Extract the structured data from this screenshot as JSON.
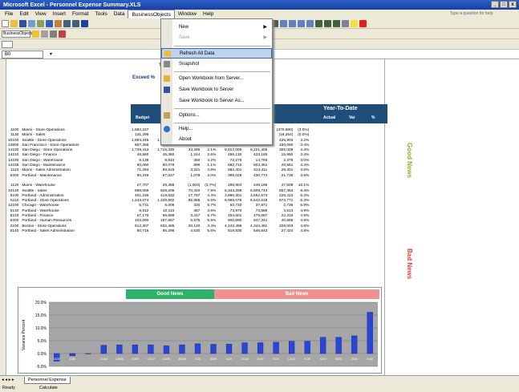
{
  "window": {
    "title": "Microsoft Excel - Personnel Expense Summary.XLS",
    "controls": [
      "_",
      "□",
      "x"
    ]
  },
  "menu": {
    "items": [
      "File",
      "Edit",
      "View",
      "Insert",
      "Format",
      "Tools",
      "Data",
      "BusinessObjects",
      "Window",
      "Help"
    ],
    "help_placeholder": "Type a question for help"
  },
  "formula": {
    "namebox": "B0"
  },
  "toolbar2": {
    "label": "BusinessObjects"
  },
  "dropdown": {
    "items": [
      {
        "label": "New",
        "arrow": "▶",
        "disabled": false
      },
      {
        "label": "Save",
        "arrow": "▶",
        "disabled": true
      },
      {
        "label": "Refresh All Data",
        "highlight": true
      },
      {
        "label": "Snapshot"
      },
      {
        "label": "Open Workbook from Server..."
      },
      {
        "label": "Save Workbook to Server"
      },
      {
        "label": "Save Workbook to Server As..."
      },
      {
        "label": "Options..."
      },
      {
        "label": "Help..."
      },
      {
        "label": "About"
      }
    ]
  },
  "report": {
    "title": "Te",
    "subtitle": "Exceed %",
    "ytd_title": "Year-To-Date",
    "col_budget": "Budget",
    "col_actual": "Actual",
    "col_var": "Var",
    "col_pct": "%",
    "side_good": "Good News",
    "side_bad": "Bad News"
  },
  "rows_good": [
    {
      "code": "1100",
      "name": "Miami - Store Operations",
      "b": "1,882,227",
      "a": "",
      "v": "",
      "p": "",
      "ytdb": "12,087,284",
      "ytda": "12,457,724",
      "ytdv": "(370,980)",
      "ytdp": "(3.0%)"
    },
    {
      "code": "1130",
      "name": "Miami - Sales",
      "b": "131,299",
      "a": "",
      "v": "",
      "p": "",
      "ytdb": "854,290",
      "ytda": "868,618",
      "ytdv": "(16,264)",
      "ytdp": "(0.0%)"
    },
    {
      "code": "10100",
      "name": "Seattle - Store Operations",
      "b": "1,894,345",
      "a": "1,780,290",
      "v": "88,810",
      "p": "5.0%",
      "ytdb": "12,894,300",
      "ytda": "12,418,471",
      "ytdv": "425,903",
      "ytdp": "3.2%"
    },
    {
      "code": "13500",
      "name": "San Francisco - Store Operations",
      "b": "657,265",
      "a": "630,000",
      "v": "22,247",
      "p": "3.7%",
      "ytdb": "4,248,844",
      "ytda": "4,088,634",
      "ytdv": "160,080",
      "ytdp": "3.4%"
    },
    {
      "code": "14100",
      "name": "San Diego - Store Operations",
      "b": "1,749,413",
      "a": "1,715,330",
      "v": "33,280",
      "p": "2.1%",
      "ytdb": "9,917,000",
      "ytda": "9,221,405",
      "ytdv": "305,009",
      "ytdp": "3.4%"
    },
    {
      "code": "14210",
      "name": "San Diego - Finance",
      "b": "46,560",
      "a": "45,360",
      "v": "1,244",
      "p": "2.6%",
      "ytdb": "456,130",
      "ytda": "433,165",
      "ytdv": "15,950",
      "ytdp": "3.4%"
    },
    {
      "code": "14230",
      "name": "San Diego - Warehouse",
      "b": "9,139",
      "a": "8,810",
      "v": "350",
      "p": "4.2%",
      "ytdb": "72,275",
      "ytda": "14,793",
      "ytdv": "2,375",
      "ytdp": "3.0%"
    },
    {
      "code": "14235",
      "name": "San Diego - Maintenance",
      "b": "80,060",
      "a": "80,079",
      "v": "896",
      "p": "1.1%",
      "ytdb": "592,710",
      "ytda": "603,361",
      "ytdv": "20,551",
      "ytdp": "3.4%"
    },
    {
      "code": "1110",
      "name": "Miami - Sales Administration",
      "b": "71,294",
      "a": "89,815",
      "v": "3,321",
      "p": "4.8%",
      "ytdb": "582,401",
      "ytda": "613,411",
      "ytdv": "29,301",
      "ytdp": "3.8%"
    },
    {
      "code": "5200",
      "name": "Portland - Maintenance",
      "b": "60,249",
      "a": "67,027",
      "v": "1,078",
      "p": "2.0%",
      "ytdb": "399,028",
      "ytda": "430,774",
      "ytdv": "21,736",
      "ytdp": "3.6%"
    }
  ],
  "rows_bad": [
    {
      "code": "1120",
      "name": "Miami - Warehouse",
      "b": "27,707",
      "a": "28,358",
      "v": "(1,003)",
      "p": "(3.7%)",
      "ytdb": "288,804",
      "ytda": "246,186",
      "ytdv": "47,608",
      "ytdp": "16.1%"
    },
    {
      "code": "10120",
      "name": "Seattle - Sales",
      "b": "899,059",
      "a": "829,206",
      "v": "70,320",
      "p": "7.8%",
      "ytdb": "6,343,298",
      "ytda": "5,809,743",
      "ytdv": "557,364",
      "ytdp": "8.4%"
    },
    {
      "code": "5100",
      "name": "Portland - Administration",
      "b": "401,236",
      "a": "419,832",
      "v": "17,797",
      "p": "4.4%",
      "ytdb": "3,890,301",
      "ytda": "3,652,673",
      "ytdv": "228,222",
      "ytdp": "6.3%"
    },
    {
      "code": "5110",
      "name": "Portland - Store Operations",
      "b": "1,243,074",
      "a": "1,328,902",
      "v": "85,865",
      "p": "6.5%",
      "ytdb": "8,969,076",
      "ytda": "8,542,618",
      "ytdv": "573,771",
      "ytdp": "6.3%"
    },
    {
      "code": "12100",
      "name": "Chicago - Warehouse",
      "b": "5,731",
      "a": "6,009",
      "v": "320",
      "p": "5.7%",
      "ytdb": "83,733",
      "ytda": "37,871",
      "ytdv": "2,736",
      "ytdp": "6.9%"
    },
    {
      "code": "5130",
      "name": "Portland - Warehouse",
      "b": "9,612",
      "a": "10,110",
      "v": "367",
      "p": "3.6%",
      "ytdb": "73,970",
      "ytda": "73,886",
      "ytdv": "3,513",
      "ytdp": "4.9%"
    },
    {
      "code": "5210",
      "name": "Portland - Finance",
      "b": "57,176",
      "a": "56,688",
      "v": "3,417",
      "p": "6.7%",
      "ytdb": "453,601",
      "ytda": "475,087",
      "ytdv": "22,316",
      "ytdp": "4.9%"
    },
    {
      "code": "5200",
      "name": "Portland - Human Resources",
      "b": "102,090",
      "a": "197,857",
      "v": "5,575",
      "p": "5.5%",
      "ytdb": "900,690",
      "ytda": "947,341",
      "ytdv": "40,556",
      "ytdp": "4.8%"
    },
    {
      "code": "2100",
      "name": "Boston - Store Operations",
      "b": "812,307",
      "a": "832,495",
      "v": "20,120",
      "p": "3.4%",
      "ytdb": "4,243,496",
      "ytda": "4,344,491",
      "ytdv": "209,003",
      "ytdp": "4.8%"
    },
    {
      "code": "5140",
      "name": "Portland - Sales Administration",
      "b": "80,716",
      "a": "85,296",
      "v": "4,530",
      "p": "5.6%",
      "ytdb": "519,830",
      "ytda": "546,843",
      "ytdv": "27,424",
      "ytdp": "4.8%"
    }
  ],
  "chart_data": {
    "type": "bar",
    "good_label": "Good News",
    "bad_label": "Bad News",
    "ylabel": "Variance Percent",
    "ylim": [
      -5,
      20
    ],
    "yticks": [
      "20.0%",
      "15.0%",
      "10.0%",
      "5.0%",
      "0.0%",
      "-5.0%"
    ],
    "categories": [
      "1100",
      "1130",
      "",
      "10100",
      "13500",
      "14100",
      "14210",
      "14230",
      "14235",
      "1110",
      "5200",
      "1120",
      "10120",
      "5100",
      "5110",
      "12100",
      "5130",
      "5210",
      "5200",
      "2100",
      "5140"
    ],
    "values": [
      -3.0,
      -0.9,
      0,
      3.2,
      3.4,
      3.4,
      3.4,
      3.0,
      3.4,
      3.8,
      3.6,
      3.7,
      4.2,
      4.2,
      4.4,
      4.8,
      4.8,
      6.3,
      6.3,
      6.9,
      16.1
    ]
  },
  "sheettab": "Personnel Expense",
  "status": {
    "left": "Ready",
    "mid": "Calculate"
  }
}
